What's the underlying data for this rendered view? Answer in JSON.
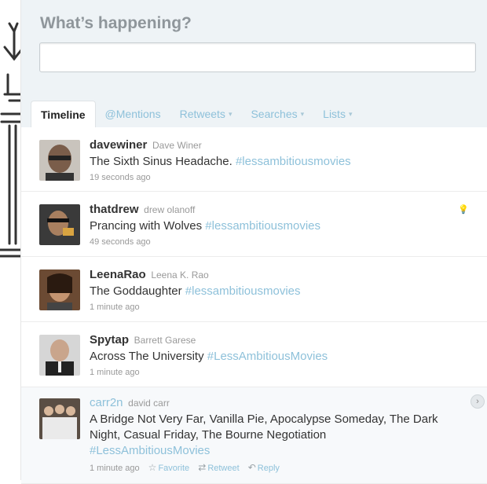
{
  "compose": {
    "prompt": "What’s happening?",
    "value": ""
  },
  "tabs": [
    {
      "label": "Timeline",
      "active": true
    },
    {
      "label": "@Mentions"
    },
    {
      "label": "Retweets",
      "dropdown": "▾"
    },
    {
      "label": "Searches",
      "dropdown": "▾"
    },
    {
      "label": "Lists",
      "dropdown": "▾"
    }
  ],
  "tweets": [
    {
      "screen_name": "davewiner",
      "full_name": "Dave Winer",
      "text": "The Sixth Sinus Headache. ",
      "hashtag": "#lessambitiousmovies",
      "time": "19 seconds ago"
    },
    {
      "screen_name": "thatdrew",
      "full_name": "drew olanoff",
      "text": "Prancing with Wolves ",
      "hashtag": "#lessambitiousmovies",
      "time": "49 seconds ago",
      "icon": "lightbulb-icon"
    },
    {
      "screen_name": "LeenaRao",
      "full_name": "Leena K. Rao",
      "text": "The Goddaughter ",
      "hashtag": "#lessambitiousmovies",
      "time": "1 minute ago"
    },
    {
      "screen_name": "Spytap",
      "full_name": "Barrett Garese",
      "text": "Across The University ",
      "hashtag": "#LessAmbitiousMovies",
      "time": "1 minute ago"
    },
    {
      "screen_name": "carr2n",
      "full_name": "david carr",
      "text": "A Bridge Not Very Far, Vanilla Pie, Apocalypse Someday, The Dark Night, Casual Friday, The Bourne Negotiation",
      "hashtag": "#LessAmbitiousMovies",
      "time": "1 minute ago",
      "actions": {
        "favorite": "Favorite",
        "retweet": "Retweet",
        "reply": "Reply"
      }
    }
  ],
  "colors": {
    "link": "#8ec1da",
    "compose_bg": "#eef3f6"
  }
}
